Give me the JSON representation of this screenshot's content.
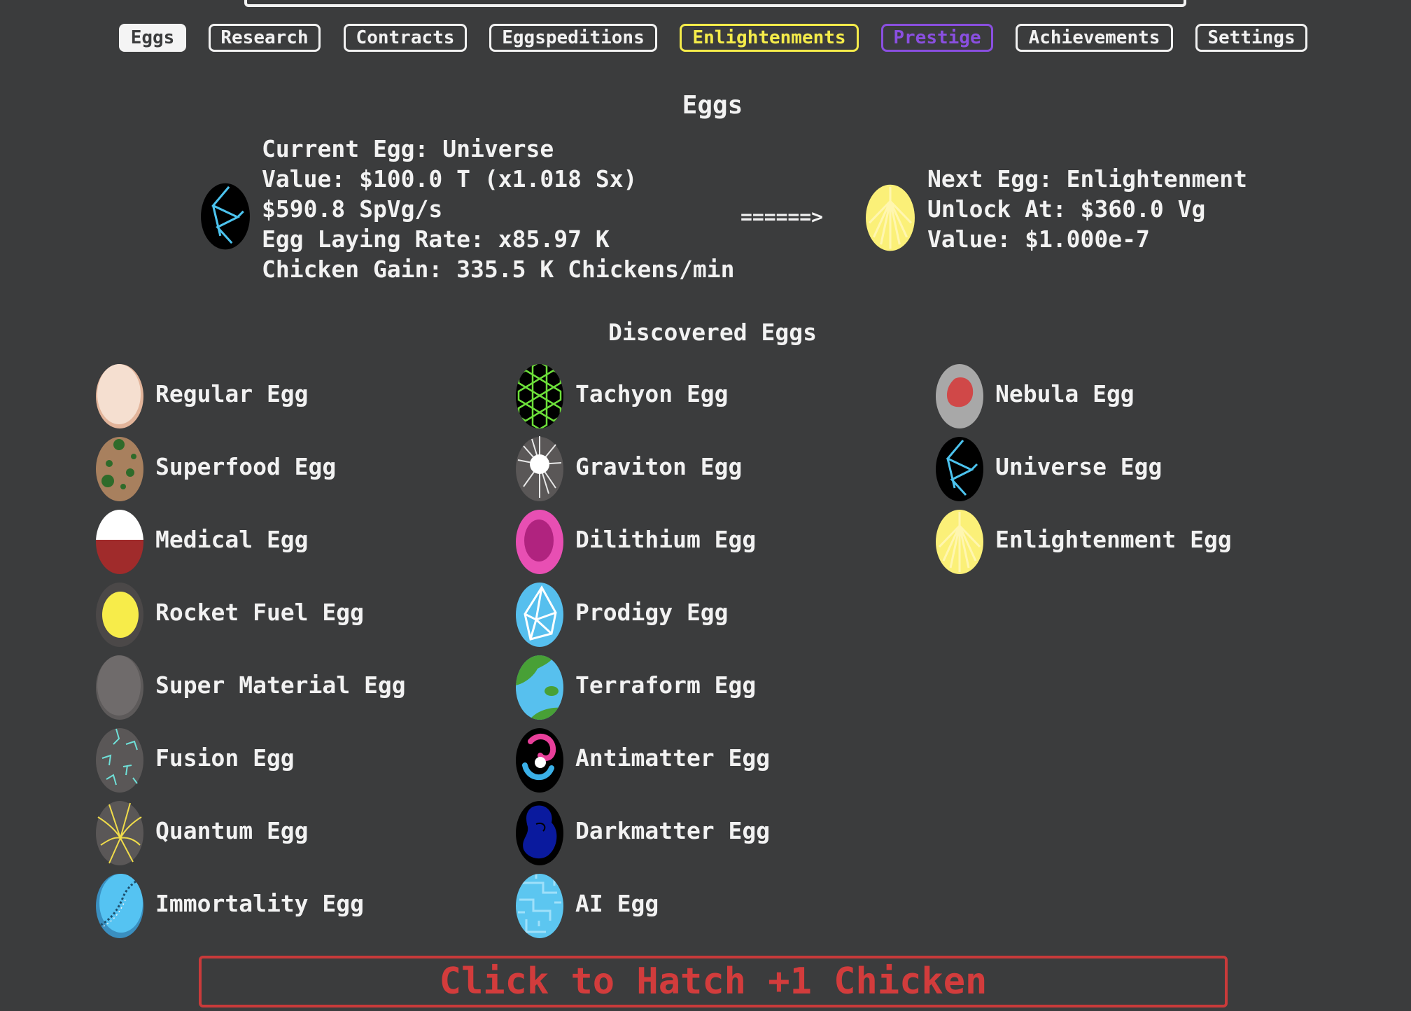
{
  "tabs": [
    {
      "label": "Eggs",
      "state": "active"
    },
    {
      "label": "Research"
    },
    {
      "label": "Contracts"
    },
    {
      "label": "Eggspeditions"
    },
    {
      "label": "Enlightenments",
      "color": "#f5ec4a"
    },
    {
      "label": "Prestige",
      "color": "#8a4fe0"
    },
    {
      "label": "Achievements"
    },
    {
      "label": "Settings"
    }
  ],
  "eggs_section": {
    "title": "Eggs",
    "current": {
      "egg_line": "Current Egg: Universe",
      "value_line": "Value: $100.0 T (x1.018 Sx)",
      "rate_line": "$590.8 SpVg/s",
      "laying_line": "Egg Laying Rate: x85.97 K",
      "gain_line": "Chicken Gain: 335.5 K Chickens/min",
      "icon": "universe-egg-icon"
    },
    "arrow": "======>",
    "next": {
      "egg_line": "Next Egg: Enlightenment",
      "unlock_line": "Unlock At: $360.0 Vg",
      "value_line": "Value: $1.000e-7",
      "icon": "enlightenment-egg-icon"
    }
  },
  "discovered": {
    "title": "Discovered Eggs",
    "eggs": [
      {
        "label": "Regular Egg",
        "icon": "regular-egg-icon"
      },
      {
        "label": "Superfood Egg",
        "icon": "superfood-egg-icon"
      },
      {
        "label": "Medical Egg",
        "icon": "medical-egg-icon"
      },
      {
        "label": "Rocket Fuel Egg",
        "icon": "rocket-fuel-egg-icon"
      },
      {
        "label": "Super Material Egg",
        "icon": "super-material-egg-icon"
      },
      {
        "label": "Fusion Egg",
        "icon": "fusion-egg-icon"
      },
      {
        "label": "Quantum Egg",
        "icon": "quantum-egg-icon"
      },
      {
        "label": "Immortality Egg",
        "icon": "immortality-egg-icon"
      },
      {
        "label": "Tachyon Egg",
        "icon": "tachyon-egg-icon"
      },
      {
        "label": "Graviton Egg",
        "icon": "graviton-egg-icon"
      },
      {
        "label": "Dilithium Egg",
        "icon": "dilithium-egg-icon"
      },
      {
        "label": "Prodigy Egg",
        "icon": "prodigy-egg-icon"
      },
      {
        "label": "Terraform Egg",
        "icon": "terraform-egg-icon"
      },
      {
        "label": "Antimatter Egg",
        "icon": "antimatter-egg-icon"
      },
      {
        "label": "Darkmatter Egg",
        "icon": "darkmatter-egg-icon"
      },
      {
        "label": "AI Egg",
        "icon": "ai-egg-icon"
      },
      {
        "label": "Nebula Egg",
        "icon": "nebula-egg-icon"
      },
      {
        "label": "Universe Egg",
        "icon": "universe-egg-icon"
      },
      {
        "label": "Enlightenment Egg",
        "icon": "enlightenment-egg-icon"
      }
    ]
  },
  "hatch_button": {
    "label": "Click to Hatch +1 Chicken",
    "color": "#d23c3c"
  }
}
